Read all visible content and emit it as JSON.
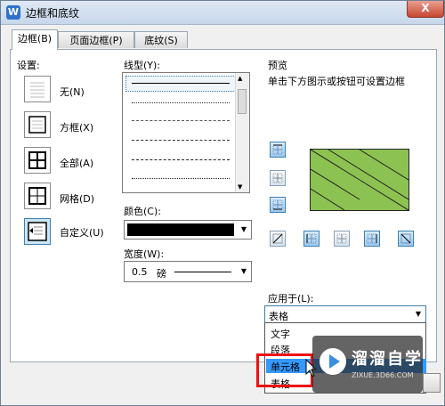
{
  "window": {
    "title": "边框和底纹",
    "app_icon": "W",
    "close": "X"
  },
  "tabs": [
    {
      "label": "边框(B)"
    },
    {
      "label": "页面边框(P)"
    },
    {
      "label": "底纹(S)"
    }
  ],
  "settings": {
    "heading": "设置:",
    "items": [
      {
        "label": "无(N)",
        "icon": "no-border-icon"
      },
      {
        "label": "方框(X)",
        "icon": "box-border-icon"
      },
      {
        "label": "全部(A)",
        "icon": "all-borders-icon"
      },
      {
        "label": "网格(D)",
        "icon": "grid-border-icon"
      },
      {
        "label": "自定义(U)",
        "icon": "custom-border-icon",
        "selected": true
      }
    ]
  },
  "line_style": {
    "heading": "线型(Y):"
  },
  "color": {
    "heading": "颜色(C):",
    "value": "#000000"
  },
  "width": {
    "heading": "宽度(W):",
    "value": "0.5",
    "unit": "磅"
  },
  "preview": {
    "heading": "预览",
    "hint": "单击下方图示或按钮可设置边框",
    "fill_color": "#8cc252"
  },
  "apply_to": {
    "heading": "应用于(L):",
    "selected": "表格",
    "options": [
      "文字",
      "段落",
      "单元格",
      "表格"
    ],
    "highlighted": "单元格"
  },
  "watermark": {
    "name": "溜溜自学",
    "url": "ZIXUE.3D66.COM"
  }
}
